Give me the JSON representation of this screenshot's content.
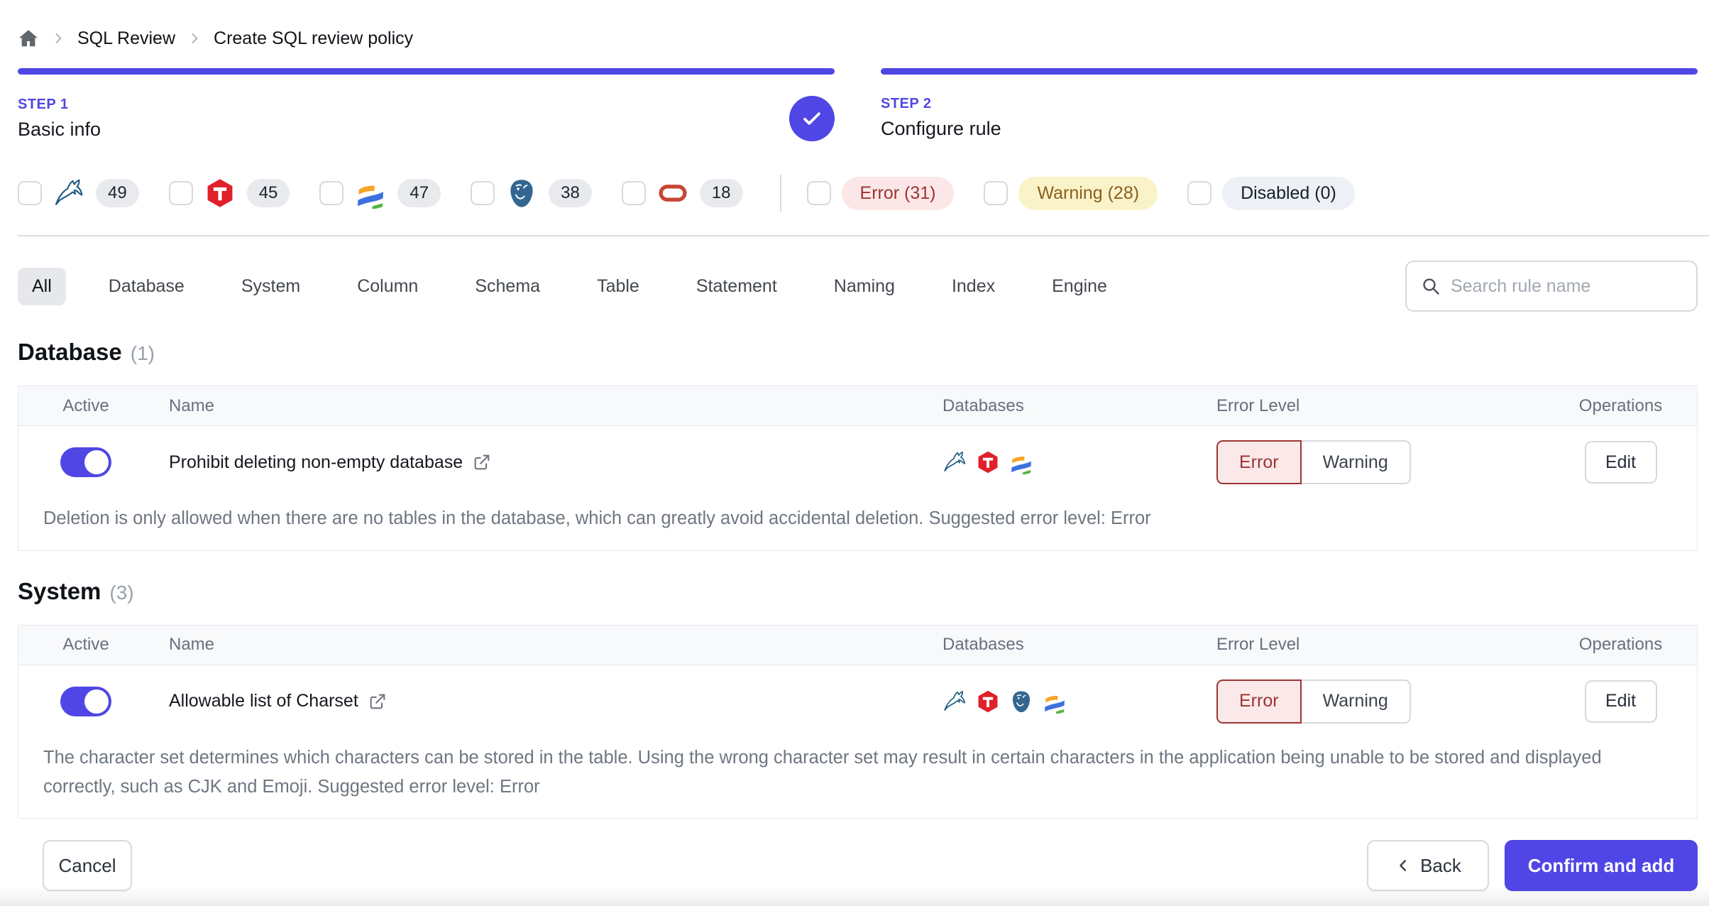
{
  "breadcrumb": {
    "items": [
      "SQL Review",
      "Create SQL review policy"
    ]
  },
  "steps": [
    {
      "label": "STEP 1",
      "title": "Basic info",
      "completed": true
    },
    {
      "label": "STEP 2",
      "title": "Configure rule",
      "completed": false
    }
  ],
  "filters": {
    "engines": [
      {
        "engine": "mysql",
        "count": "49"
      },
      {
        "engine": "tidb",
        "count": "45"
      },
      {
        "engine": "oceanbase",
        "count": "47"
      },
      {
        "engine": "postgresql",
        "count": "38"
      },
      {
        "engine": "oracle",
        "count": "18"
      }
    ],
    "levels": [
      {
        "label": "Error (31)",
        "type": "error"
      },
      {
        "label": "Warning (28)",
        "type": "warning"
      },
      {
        "label": "Disabled (0)",
        "type": "disabled"
      }
    ]
  },
  "tabs": [
    {
      "label": "All",
      "selected": true
    },
    {
      "label": "Database"
    },
    {
      "label": "System"
    },
    {
      "label": "Column"
    },
    {
      "label": "Schema"
    },
    {
      "label": "Table"
    },
    {
      "label": "Statement"
    },
    {
      "label": "Naming"
    },
    {
      "label": "Index"
    },
    {
      "label": "Engine"
    }
  ],
  "search": {
    "placeholder": "Search rule name"
  },
  "columns": {
    "active": "Active",
    "name": "Name",
    "databases": "Databases",
    "level": "Error Level",
    "operations": "Operations"
  },
  "ui": {
    "error": "Error",
    "warning": "Warning",
    "edit": "Edit"
  },
  "sections": [
    {
      "title": "Database",
      "count": "(1)",
      "rows": [
        {
          "name": "Prohibit deleting non-empty database",
          "active": true,
          "engines": [
            "mysql",
            "tidb",
            "oceanbase"
          ],
          "selected_level": "Error",
          "description": "Deletion is only allowed when there are no tables in the database, which can greatly avoid accidental deletion. Suggested error level: Error"
        }
      ]
    },
    {
      "title": "System",
      "count": "(3)",
      "rows": [
        {
          "name": "Allowable list of Charset",
          "active": true,
          "engines": [
            "mysql",
            "tidb",
            "postgresql",
            "oceanbase"
          ],
          "selected_level": "Error",
          "description": "The character set determines which characters can be stored in the table. Using the wrong character set may result in certain characters in the application being unable to be stored and displayed correctly, such as CJK and Emoji. Suggested error level: Error"
        }
      ]
    }
  ],
  "footer": {
    "cancel": "Cancel",
    "back": "Back",
    "confirm": "Confirm and add"
  },
  "colors": {
    "accent": "#4f46e5",
    "error_text": "#9d3434",
    "error_bg": "#fbe9e9",
    "warning_bg": "#faf3c9",
    "warning_text": "#8a5f1e",
    "disabled_bg": "#edf0f4",
    "badge_bg": "#e9eaed"
  }
}
